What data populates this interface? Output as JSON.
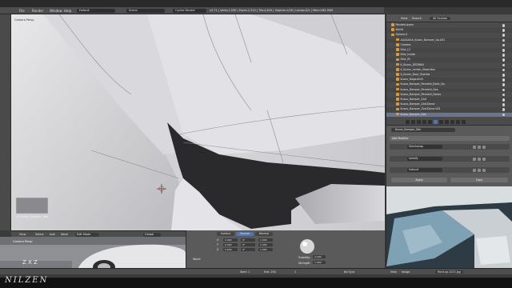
{
  "topbar": {
    "menus": [
      "File",
      "Render",
      "Window",
      "Help"
    ],
    "layout": "Default",
    "scene": "Scene",
    "engine": "Cycles Render",
    "stats": "v2.71 | Verts:2,530 | Faces:2,310 | Tris:4,620 | Objects:1/16 | Lamps:0/1 | Mem:184.95M"
  },
  "viewport": {
    "label": "Camera Persp",
    "object_label": "(1) Kuzov_Bamper_Sbk"
  },
  "viewport_header": {
    "view": "View",
    "select": "Select",
    "add": "Add",
    "mesh": "Mesh",
    "mode": "Edit Mode",
    "pivot": "Global",
    "snap": "Closest"
  },
  "cam_preview": {
    "label": "Camera Persp",
    "axis_text": "Z X Z"
  },
  "mat_panel": {
    "tabs": [
      "Surface",
      "Volume",
      "Normal"
    ],
    "rows": [
      {
        "a": "X",
        "b": "0.000",
        "c": "0°",
        "d": "1.000"
      },
      {
        "a": "Y",
        "b": "0.000",
        "c": "0°",
        "d": "1.000"
      },
      {
        "a": "Z",
        "b": "0.000",
        "c": "0°",
        "d": "1.000"
      }
    ],
    "world_label": "World",
    "turbidity_label": "Turbidity:",
    "turbidity_value": "2.200",
    "strength_label": "Strength:",
    "strength_value": "1.000"
  },
  "outliner": {
    "header": {
      "view": "View",
      "search": "Search",
      "filter": "All Scenes"
    },
    "items": [
      {
        "label": "RenderLayers",
        "selected": false
      },
      {
        "label": "World",
        "selected": false
      },
      {
        "label": "Sphere.0",
        "selected": false
      },
      {
        "label": "AAAAAAA_Kuzov_Bamper_Up.001",
        "selected": false
      },
      {
        "label": "Camera",
        "selected": false
      },
      {
        "label": "Disk_L2",
        "selected": false
      },
      {
        "label": "Disk_Inside",
        "selected": false
      },
      {
        "label": "Disk_Rt",
        "selected": false
      },
      {
        "label": "K_Kuzov_DEDRAN",
        "selected": false
      },
      {
        "label": "K_Kuzov_center_Steamliss",
        "selected": false
      },
      {
        "label": "K_Kuzov_Door_Ruchka",
        "selected": false
      },
      {
        "label": "Kuzov_Bagazhnik",
        "selected": false
      },
      {
        "label": "Kuzov_Bamper_Perednii_Back_Up",
        "selected": false
      },
      {
        "label": "Kuzov_Bamper_Perednii_Nos",
        "selected": false
      },
      {
        "label": "Kuzov_Bamper_Perednii_Nosss",
        "selected": false
      },
      {
        "label": "Kuzov_Bamper_Zad",
        "selected": false
      },
      {
        "label": "Kuzov_Bamper_Zad.Decor",
        "selected": false
      },
      {
        "label": "Kuzov_Bamper_Zad.Decor.001",
        "selected": false
      },
      {
        "label": "Kuzov_Bamper_Sbk",
        "selected": true
      }
    ]
  },
  "properties": {
    "object_name": "Kuzov_Bamper_Sbk",
    "add_modifier": "Add Modifier",
    "modifiers": [
      "Shrinkwrap",
      "Solidify",
      "Subsurf"
    ],
    "apply_label": "Apply",
    "copy_label": "Copy"
  },
  "image_view": {
    "view": "View",
    "image": "Image",
    "file": "Rend.gs.2013.jpg"
  },
  "bottom_bar": {
    "items": [
      "Start: 1",
      "End: 250",
      "1",
      "No Sync"
    ]
  },
  "watermark": "NILZEN",
  "colors": {
    "panel": "#4b4b4b",
    "header": "#4d4d4d",
    "selection": "#6b7590",
    "object_icon": "#e09a3a"
  }
}
